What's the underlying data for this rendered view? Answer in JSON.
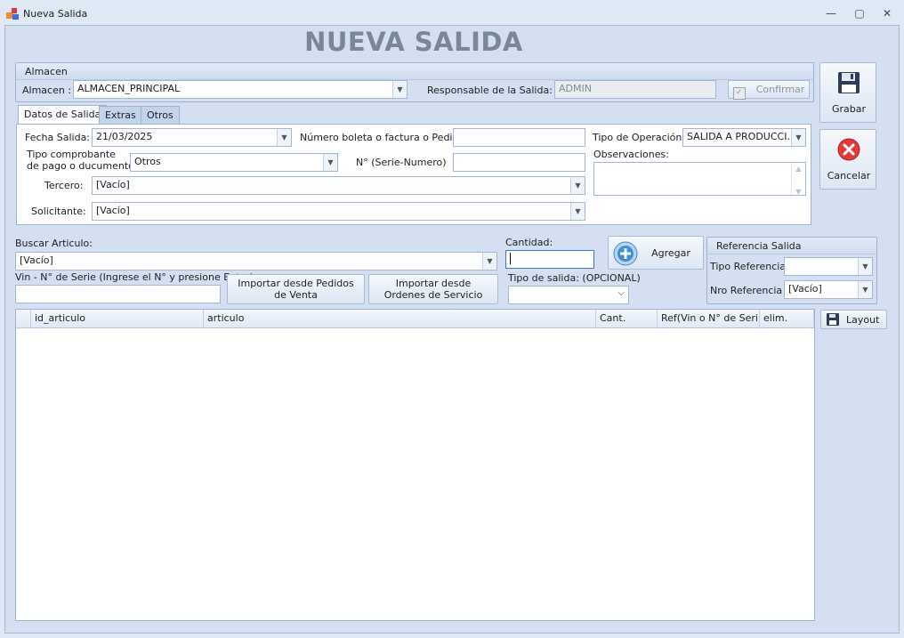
{
  "window": {
    "title": "Nueva Salida",
    "minimize": "—",
    "maximize": "▢",
    "close": "✕"
  },
  "heading": "NUEVA SALIDA",
  "almacen_group": {
    "title": "Almacen",
    "almacen_label": "Almacen :",
    "almacen_value": "ALMACEN_PRINCIPAL",
    "responsable_label": "Responsable de la Salida:",
    "responsable_value": "ADMIN",
    "confirmar_label": "Confirmar"
  },
  "tabs": [
    "Datos de Salida",
    "Extras",
    "Otros"
  ],
  "datos": {
    "fecha_label": "Fecha Salida:",
    "fecha_value": "21/03/2025",
    "numero_label": "Número boleta o factura o Pedido",
    "numero_value": "",
    "tipo_op_label": "Tipo de Operación:",
    "tipo_op_value": "SALIDA A PRODUCCI...",
    "tipo_comp_label_1": "Tipo comprobante",
    "tipo_comp_label_2": "de pago o ducumento :",
    "tipo_comp_value": "Otros",
    "serie_label": "N° (Serie-Numero)",
    "serie_value": "",
    "observaciones_label": "Observaciones:",
    "observaciones_value": "",
    "tercero_label": "Tercero:",
    "tercero_value": "[Vacío]",
    "solicitante_label": "Solicitante:",
    "solicitante_value": "[Vacío]"
  },
  "actions": {
    "grabar": "Grabar",
    "cancelar": "Cancelar",
    "layout": "Layout",
    "agregar": "Agregar"
  },
  "articulo": {
    "buscar_label": "Buscar Articulo:",
    "buscar_value": "[Vacío]",
    "cantidad_label": "Cantidad:",
    "cantidad_value": "",
    "vin_label": "Vin - N° de Serie (Ingrese el N° y presione Enter)",
    "vin_value": "",
    "importar_pedidos": "Importar desde Pedidos de Venta",
    "importar_ordenes": "Importar desde Ordenes de Servicio",
    "tipo_salida_label": "Tipo de salida: (OPCIONAL)",
    "tipo_salida_value": ""
  },
  "referencia": {
    "title": "Referencia Salida",
    "tipo_label": "Tipo Referencia",
    "tipo_value": "",
    "nro_label": "Nro Referencia",
    "nro_value": "[Vacío]"
  },
  "grid": {
    "columns": [
      "id_articulo",
      "articulo",
      "Cant.",
      "Ref(Vin o N° de Seri...",
      "elim."
    ],
    "rows": []
  },
  "colors": {
    "heading": "#7a8797",
    "window_bg": "#d4e0f1",
    "cancel_icon": "#e03a3a",
    "add_icon": "#3d8fd8"
  }
}
